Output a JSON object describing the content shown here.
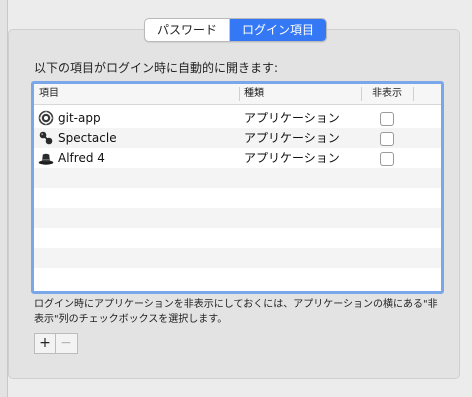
{
  "tabs": [
    {
      "label": "パスワード",
      "active": false
    },
    {
      "label": "ログイン項目",
      "active": true
    }
  ],
  "intro_text": "以下の項目がログイン時に自動的に開きます:",
  "table": {
    "columns": [
      "項目",
      "種類",
      "非表示"
    ],
    "rows": [
      {
        "icon": "git-app-icon",
        "name": "git-app",
        "kind": "アプリケーション",
        "hidden": false
      },
      {
        "icon": "spectacle-icon",
        "name": "Spectacle",
        "kind": "アプリケーション",
        "hidden": false
      },
      {
        "icon": "alfred-icon",
        "name": "Alfred 4",
        "kind": "アプリケーション",
        "hidden": false
      }
    ]
  },
  "footnote": "ログイン時にアプリケーションを非表示にしておくには、アプリケーションの横にある\"非表示\"列のチェックボックスを選択します。",
  "buttons": {
    "add": "+",
    "remove": "−"
  },
  "colors": {
    "accent": "#3478f6",
    "focus_ring": "#7aa7ea"
  }
}
